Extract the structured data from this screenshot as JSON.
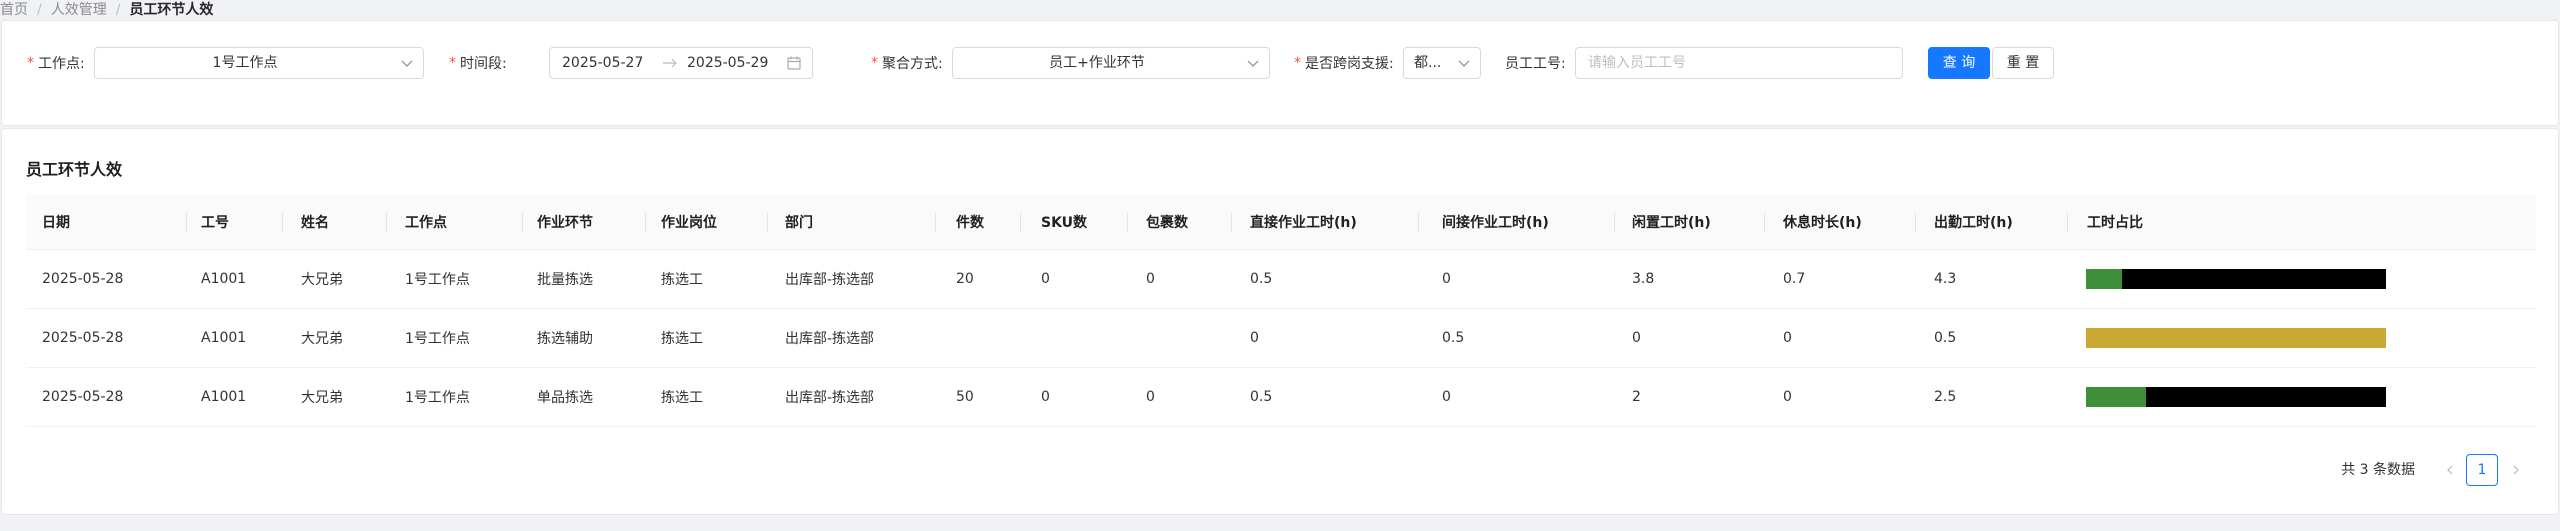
{
  "breadcrumb": {
    "items": [
      "首页",
      "人效管理"
    ],
    "current": "员工环节人效",
    "separator": "/"
  },
  "filters": {
    "workpoint": {
      "label": "工作点:",
      "value": "1号工作点"
    },
    "period": {
      "label": "时间段:",
      "start": "2025-05-27",
      "end": "2025-05-29"
    },
    "aggregation": {
      "label": "聚合方式:",
      "value": "员工+作业环节"
    },
    "cross_post": {
      "label": "是否跨岗支援:",
      "value": "都..."
    },
    "employee_id": {
      "label": "员工工号:",
      "placeholder": "请输入员工工号"
    },
    "required_mark": "*",
    "query_label": "查 询",
    "reset_label": "重 置"
  },
  "table": {
    "title": "员工环节人效",
    "columns": [
      "日期",
      "工号",
      "姓名",
      "工作点",
      "作业环节",
      "作业岗位",
      "部门",
      "件数",
      "SKU数",
      "包裹数",
      "直接作业工时(h)",
      "间接作业工时(h)",
      "闲置工时(h)",
      "休息时长(h)",
      "出勤工时(h)",
      "工时占比"
    ],
    "rows": [
      {
        "date": "2025-05-28",
        "emp_id": "A1001",
        "name": "大兄弟",
        "workpoint": "1号工作点",
        "link": "批量拣选",
        "post": "拣选工",
        "dept": "出库部-拣选部",
        "pieces": "20",
        "sku": "0",
        "packages": "0",
        "direct_h": "0.5",
        "indirect_h": "0",
        "idle_h": "3.8",
        "rest_h": "0.7",
        "attend_h": "4.3"
      },
      {
        "date": "2025-05-28",
        "emp_id": "A1001",
        "name": "大兄弟",
        "workpoint": "1号工作点",
        "link": "拣选辅助",
        "post": "拣选工",
        "dept": "出库部-拣选部",
        "pieces": "",
        "sku": "",
        "packages": "",
        "direct_h": "0",
        "indirect_h": "0.5",
        "idle_h": "0",
        "rest_h": "0",
        "attend_h": "0.5"
      },
      {
        "date": "2025-05-28",
        "emp_id": "A1001",
        "name": "大兄弟",
        "workpoint": "1号工作点",
        "link": "单品拣选",
        "post": "拣选工",
        "dept": "出库部-拣选部",
        "pieces": "50",
        "sku": "0",
        "packages": "0",
        "direct_h": "0.5",
        "indirect_h": "0",
        "idle_h": "2",
        "rest_h": "0",
        "attend_h": "2.5"
      }
    ],
    "ratio_bars": [
      [
        {
          "color": "#3f8f3a",
          "fraction": 0.12
        },
        {
          "color": "#000000",
          "fraction": 0.88
        }
      ],
      [
        {
          "color": "#c9a934",
          "fraction": 1.0
        }
      ],
      [
        {
          "color": "#3f8f3a",
          "fraction": 0.2
        },
        {
          "color": "#000000",
          "fraction": 0.8
        }
      ]
    ]
  },
  "pagination": {
    "total_text": "共 3 条数据",
    "current_page": "1"
  },
  "icons": {
    "select_arrow": "chevron-down-icon",
    "range_arrow": "arrow-right-icon",
    "calendar": "calendar-icon",
    "prev": "chevron-left-icon",
    "next": "chevron-right-icon"
  }
}
